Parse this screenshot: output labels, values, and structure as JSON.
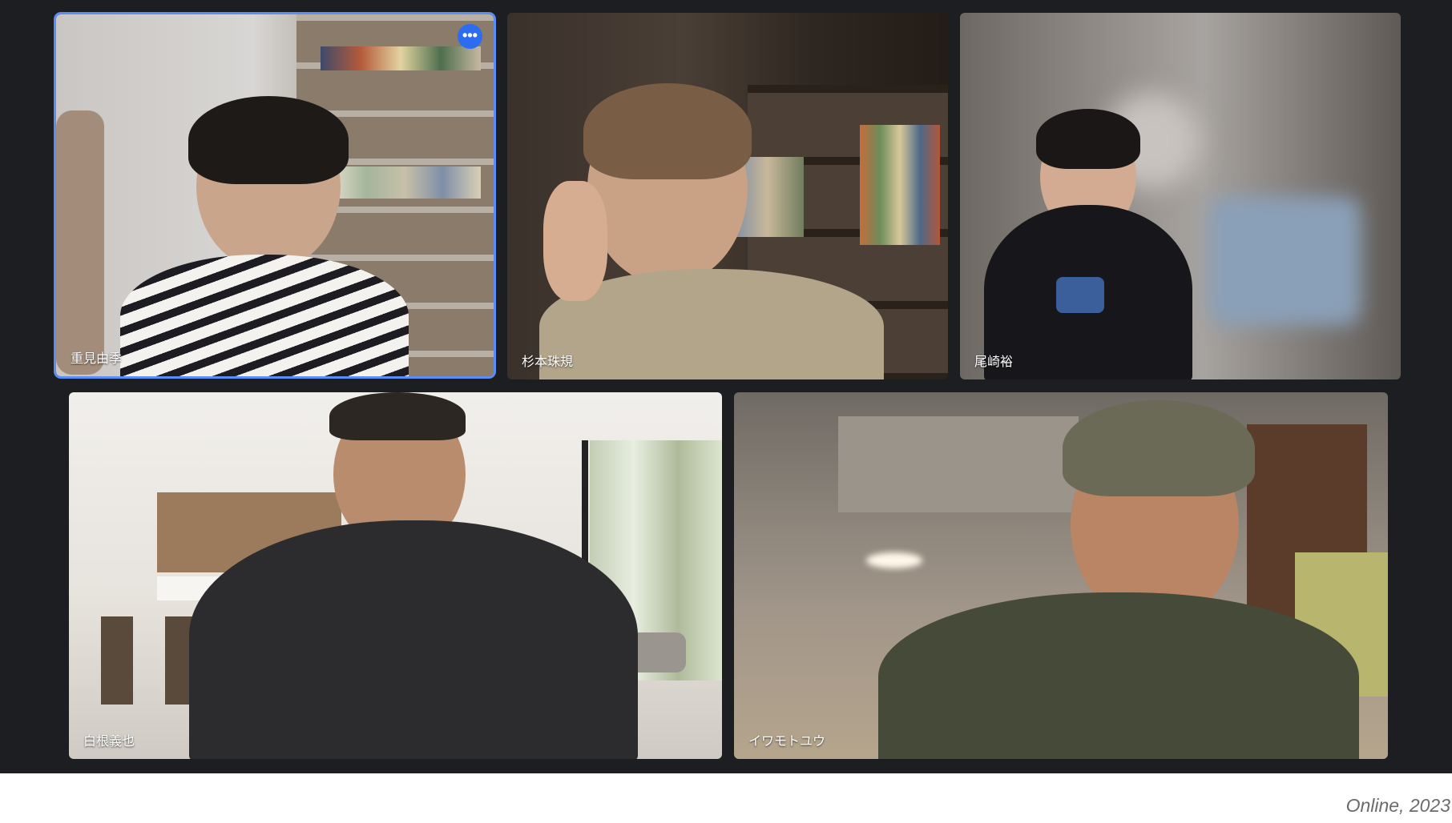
{
  "participants": [
    {
      "name": "重見由季",
      "active": true,
      "more_icon": "more-horizontal-icon"
    },
    {
      "name": "杉本珠規",
      "active": false
    },
    {
      "name": "尾崎裕",
      "active": false
    },
    {
      "name": "白根義也",
      "active": false
    },
    {
      "name": "イワモトユウ",
      "active": false
    }
  ],
  "more_button_label": "•••",
  "caption": "Online, 2023",
  "colors": {
    "meeting_background": "#1d1e22",
    "active_border": "#5b8df5",
    "more_button": "#2d6cf0"
  }
}
